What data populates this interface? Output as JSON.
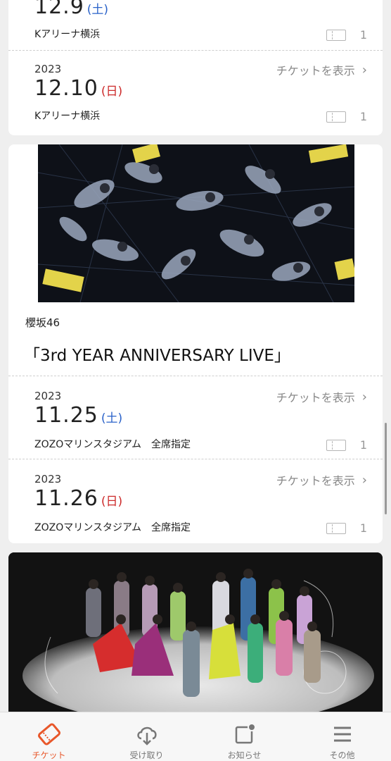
{
  "card1": {
    "entries": [
      {
        "year": "",
        "date": "12.9",
        "dow": "(土)",
        "venue": "Kアリーナ横浜",
        "count": "1",
        "show_label": ""
      },
      {
        "year": "2023",
        "date": "12.10",
        "dow": "(日)",
        "venue": "Kアリーナ横浜",
        "count": "1",
        "show_label": "チケットを表示"
      }
    ]
  },
  "card2": {
    "artist": "櫻坂46",
    "title": "「3rd YEAR ANNIVERSARY LIVE」",
    "entries": [
      {
        "year": "2023",
        "date": "11.25",
        "dow": "(土)",
        "venue": "ZOZOマリンスタジアム　全席指定",
        "count": "1",
        "show_label": "チケットを表示"
      },
      {
        "year": "2023",
        "date": "11.26",
        "dow": "(日)",
        "venue": "ZOZOマリンスタジアム　全席指定",
        "count": "1",
        "show_label": "チケットを表示"
      }
    ]
  },
  "tabs": [
    {
      "label": "チケット",
      "icon": "ticket-icon",
      "active": true
    },
    {
      "label": "受け取り",
      "icon": "cloud-download-icon",
      "active": false
    },
    {
      "label": "お知らせ",
      "icon": "notification-icon",
      "active": false
    },
    {
      "label": "その他",
      "icon": "menu-icon",
      "active": false
    }
  ],
  "colors": {
    "accent": "#e8572a",
    "saturday": "#2a62c9",
    "sunday": "#cc2a2a"
  }
}
